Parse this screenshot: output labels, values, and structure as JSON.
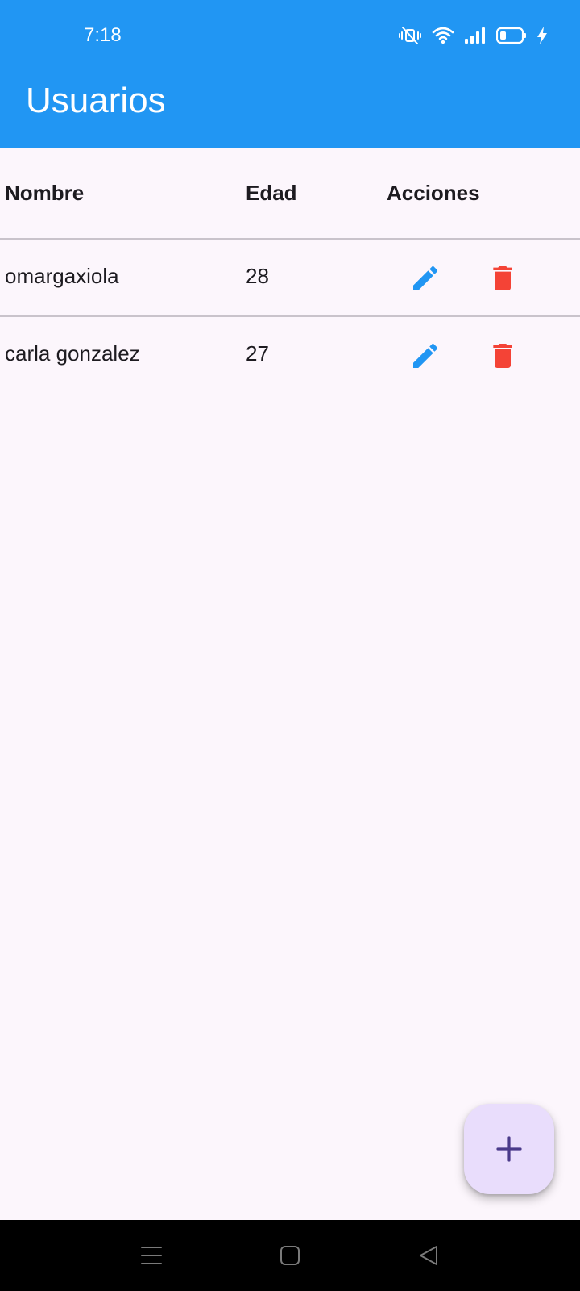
{
  "status_bar": {
    "time": "7:18",
    "icons": [
      "vibrate-silent-icon",
      "wifi-icon",
      "signal-icon",
      "battery-icon",
      "charging-icon"
    ]
  },
  "app_bar": {
    "title": "Usuarios",
    "color": "#2196f3"
  },
  "table": {
    "headers": {
      "name": "Nombre",
      "age": "Edad",
      "actions": "Acciones"
    },
    "rows": [
      {
        "name": "omargaxiola",
        "age": "28"
      },
      {
        "name": "carla gonzalez",
        "age": "27"
      }
    ],
    "edit_icon": "pencil-icon",
    "delete_icon": "trash-icon",
    "edit_color": "#2196f3",
    "delete_color": "#f44336"
  },
  "fab": {
    "icon": "plus-icon",
    "background": "#e9ddfc",
    "icon_color": "#4a3a8a"
  },
  "nav_bar": {
    "icons": [
      "menu-icon",
      "home-square-icon",
      "back-triangle-icon"
    ]
  }
}
